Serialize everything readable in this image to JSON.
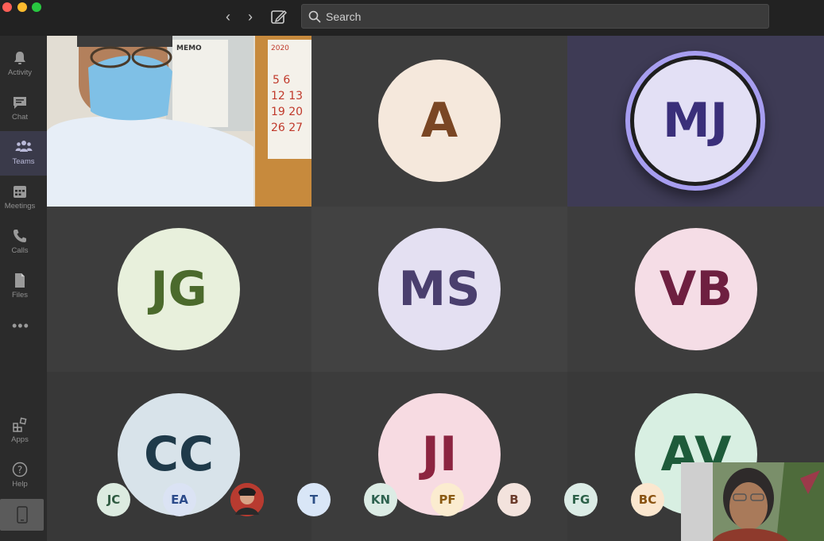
{
  "titlebar": {
    "search_placeholder": "Search"
  },
  "rail": {
    "items": [
      {
        "label": "Activity",
        "icon": "bell-icon"
      },
      {
        "label": "Chat",
        "icon": "chat-icon"
      },
      {
        "label": "Teams",
        "icon": "teams-icon",
        "active": true
      },
      {
        "label": "Meetings",
        "icon": "calendar-icon"
      },
      {
        "label": "Calls",
        "icon": "phone-icon"
      },
      {
        "label": "Files",
        "icon": "file-icon"
      }
    ],
    "more": "•••",
    "apps_label": "Apps",
    "help_label": "Help"
  },
  "tiles": [
    {
      "initials": "A",
      "bg": "#f5e8dc",
      "fg": "#7a4624"
    },
    {
      "initials": "MJ",
      "bg": "#e3e0f5",
      "fg": "#3a2f7a",
      "speaking": true
    },
    {
      "initials": "JG",
      "bg": "#e8f0dc",
      "fg": "#4b6a2c"
    },
    {
      "initials": "MS",
      "bg": "#e4e0f2",
      "fg": "#4a3f6e"
    },
    {
      "initials": "VB",
      "bg": "#f5dde6",
      "fg": "#6e1f40"
    },
    {
      "initials": "CC",
      "bg": "#d8e3ea",
      "fg": "#1f3a4a"
    },
    {
      "initials": "JI",
      "bg": "#f7dbe2",
      "fg": "#8c2440"
    },
    {
      "initials": "AV",
      "bg": "#d8efe2",
      "fg": "#1e5b3a"
    }
  ],
  "overflow": [
    {
      "initials": "JC",
      "bg": "#dcebe0",
      "fg": "#2e5a40"
    },
    {
      "initials": "EA",
      "bg": "#dbe3f4",
      "fg": "#2b4a8a"
    },
    {
      "initials": "",
      "bg": "#c0392b",
      "fg": "#ffffff",
      "photo": true
    },
    {
      "initials": "T",
      "bg": "#d9e6f7",
      "fg": "#2d4f86"
    },
    {
      "initials": "KN",
      "bg": "#dcece5",
      "fg": "#2e6350"
    },
    {
      "initials": "PF",
      "bg": "#fbecd0",
      "fg": "#8a5a12"
    },
    {
      "initials": "B",
      "bg": "#f3e3dd",
      "fg": "#6b3b2b"
    },
    {
      "initials": "FG",
      "bg": "#dcece6",
      "fg": "#2c6048"
    },
    {
      "initials": "BC",
      "bg": "#fbe7cf",
      "fg": "#8a5312"
    }
  ]
}
